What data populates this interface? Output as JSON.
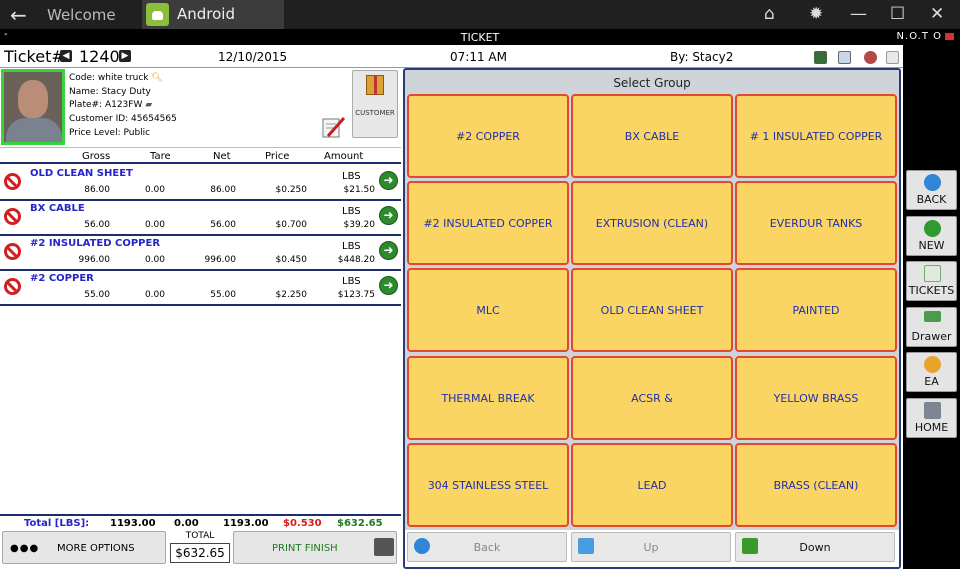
{
  "window": {
    "tabs": [
      {
        "label": "Welcome"
      },
      {
        "label": "Android"
      }
    ]
  },
  "screen_title": "TICKET",
  "brand": "N.O.T O",
  "header": {
    "ticket_label": "Ticket#",
    "ticket_number": "1240",
    "date": "12/10/2015",
    "time": "07:11 AM",
    "by": "By: Stacy2"
  },
  "customer": {
    "code": "Code: white truck",
    "name": "Name: Stacy Duty",
    "plate": "Plate#: A123FW",
    "customer_id": "Customer ID: 45654565",
    "price_level": "Price Level: Public",
    "button_label": "CUSTOMER"
  },
  "columns": [
    "Gross",
    "Tare",
    "Net",
    "Price",
    "Amount"
  ],
  "lines": [
    {
      "name": "OLD CLEAN SHEET",
      "gross": "86.00",
      "tare": "0.00",
      "net": "86.00",
      "price": "$0.250",
      "unit": "LBS",
      "amount": "$21.50"
    },
    {
      "name": "BX CABLE",
      "gross": "56.00",
      "tare": "0.00",
      "net": "56.00",
      "price": "$0.700",
      "unit": "LBS",
      "amount": "$39.20"
    },
    {
      "name": "#2 INSULATED COPPER",
      "gross": "996.00",
      "tare": "0.00",
      "net": "996.00",
      "price": "$0.450",
      "unit": "LBS",
      "amount": "$448.20"
    },
    {
      "name": "#2 COPPER",
      "gross": "55.00",
      "tare": "0.00",
      "net": "55.00",
      "price": "$2.250",
      "unit": "LBS",
      "amount": "$123.75"
    }
  ],
  "totals": {
    "label": "Total [LBS]:",
    "gross": "1193.00",
    "tare": "0.00",
    "net": "1193.00",
    "price": "$0.530",
    "amount": "$632.65"
  },
  "bottom": {
    "more_dots": "●●●",
    "more_options": "MORE OPTIONS",
    "total_label": "TOTAL",
    "total_value": "$632.65",
    "print_finish": "PRINT FINISH"
  },
  "group_panel": {
    "title": "Select Group",
    "groups": [
      "#2 COPPER",
      "BX CABLE",
      "# 1 INSULATED COPPER",
      "#2 INSULATED COPPER",
      "EXTRUSION (CLEAN)",
      "EVERDUR TANKS",
      "MLC",
      "OLD CLEAN SHEET",
      "PAINTED",
      "THERMAL BREAK",
      "ACSR &",
      "YELLOW BRASS",
      "304 STAINLESS STEEL",
      "LEAD",
      "BRASS (CLEAN)"
    ],
    "nav": {
      "back": "Back",
      "up": "Up",
      "down": "Down"
    }
  },
  "side_nav": {
    "back": "BACK",
    "new": "NEW",
    "tickets": "TICKETS",
    "drawer": "Drawer",
    "ea": "EA",
    "home": "HOME"
  },
  "colors": {
    "group_fill": "#fbd563",
    "group_border": "#e4492f",
    "group_text": "#1f2faa",
    "item_text": "#2424c8",
    "row_divider": "#1d2d6b",
    "photo_border": "#3bd33b"
  }
}
